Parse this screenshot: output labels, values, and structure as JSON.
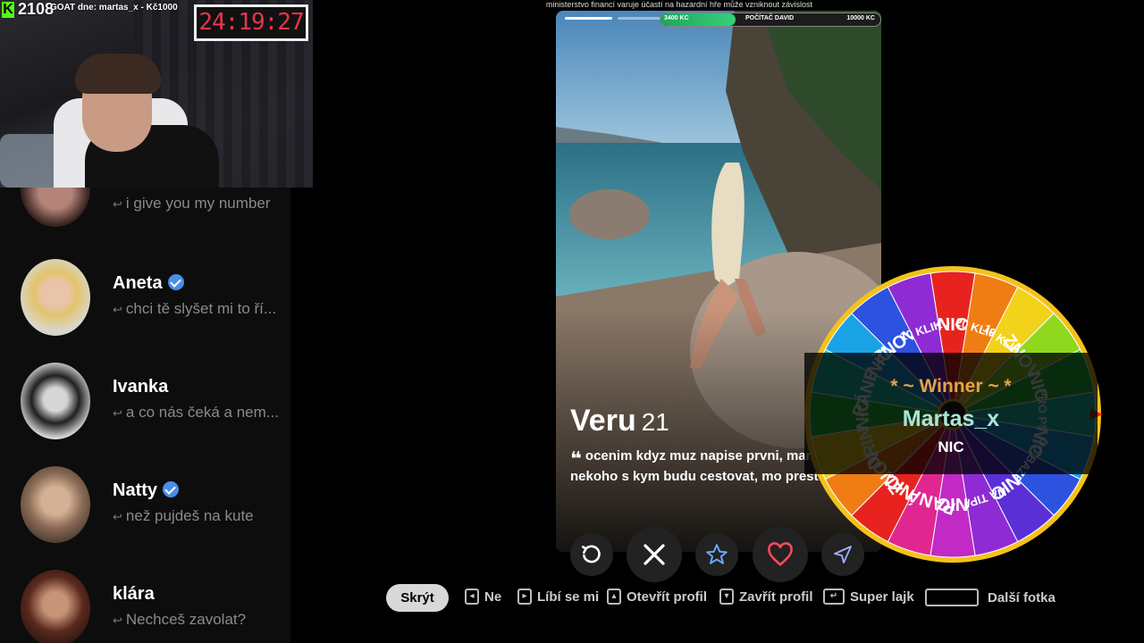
{
  "stream": {
    "viewer_count": "2108",
    "goat_text": "GOAT dne: martas_x - Kč1000",
    "timer": "24:19:27",
    "disclaimer": "ministerstvo financí varuje účastí na hazardní hře může vzniknout závislost"
  },
  "goal": {
    "current": "3400 KC",
    "title": "POČÍTAČ DAVID",
    "target": "10000 KC",
    "progress_fraction": 0.34,
    "color": "#2ec46e"
  },
  "chats": [
    {
      "name": "",
      "verified": false,
      "message": "i give you my number"
    },
    {
      "name": "Aneta",
      "verified": true,
      "message": "chci tě slyšet mi to ří..."
    },
    {
      "name": "Ivanka",
      "verified": false,
      "message": "a co nás čeká a nem..."
    },
    {
      "name": "Natty",
      "verified": true,
      "message": "než pujdeš na kute"
    },
    {
      "name": "klára",
      "verified": false,
      "message": "Nechceš zavolat?"
    }
  ],
  "profile": {
    "name": "Veru",
    "age": "21",
    "bio": "ocenim kdyz muz napise prvni, mam hledam nekoho s kym budu cestovat, mo prestehovat z cz",
    "photo_count": 6,
    "active_photo": 1
  },
  "actions": [
    {
      "name": "rewind-button",
      "icon": "rewind-icon",
      "color": "#ffffff"
    },
    {
      "name": "nope-button",
      "icon": "close-icon",
      "color": "#ffffff"
    },
    {
      "name": "super-like-button",
      "icon": "star-icon",
      "color": "#6aa8ff"
    },
    {
      "name": "like-button",
      "icon": "heart-icon",
      "color": "#ff4a5a"
    },
    {
      "name": "boost-button",
      "icon": "send-icon",
      "color": "#9fb0ff"
    }
  ],
  "hints": {
    "hide": "Skrýt",
    "no": "Ne",
    "like": "Líbí se mi",
    "open_profile": "Otevřít profil",
    "close_profile": "Zavřít profil",
    "super_like": "Super lajk",
    "next_photo": "Další fotka"
  },
  "wheel": {
    "segments": [
      {
        "label": "NIC",
        "color": "#e8231f"
      },
      {
        "label": "20 KLIKU",
        "color": "#f07d14"
      },
      {
        "label": "10 KLIKU",
        "color": "#f2d21a"
      },
      {
        "label": "ZNOVU",
        "color": "#8fd81e"
      },
      {
        "label": "NIC",
        "color": "#27c43c"
      },
      {
        "label": "PRO PSA",
        "color": "#1cc8b4"
      },
      {
        "label": "NIC",
        "color": "#19a3e6"
      },
      {
        "label": "DO BAZENU",
        "color": "#2d52e0"
      },
      {
        "label": "NIC",
        "color": "#5a2fd6"
      },
      {
        "label": "NA TIPAČ",
        "color": "#8e2bd4"
      },
      {
        "label": "NIC",
        "color": "#c12ac4"
      },
      {
        "label": "PANÁK",
        "color": "#e02790"
      },
      {
        "label": "NIC",
        "color": "#e8231f"
      },
      {
        "label": "ZNOVU",
        "color": "#f07d14"
      },
      {
        "label": "DRINK",
        "color": "#f2d21a"
      },
      {
        "label": "NIC",
        "color": "#27c43c"
      },
      {
        "label": "PÁNEK",
        "color": "#1cc8b4"
      },
      {
        "label": "NIC",
        "color": "#19a3e6"
      },
      {
        "label": "ZNOVU",
        "color": "#2d52e0"
      },
      {
        "label": "10 KLIKU",
        "color": "#8e2bd4"
      }
    ],
    "winner_label": "* ~ Winner ~ *",
    "winner_name": "Martas_x",
    "winner_prize": "NIC"
  }
}
